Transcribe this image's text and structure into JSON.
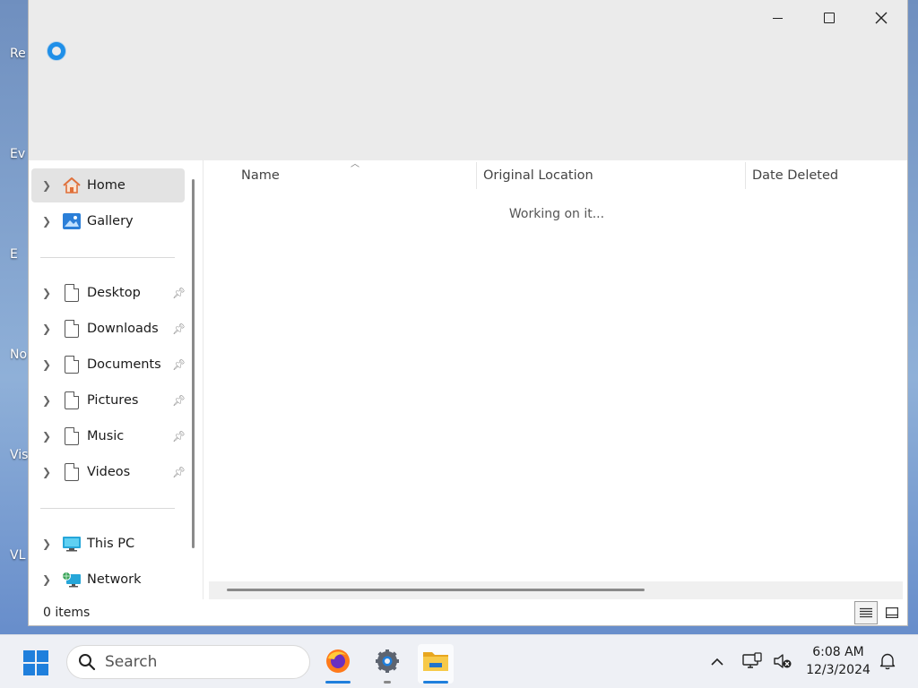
{
  "desktop": {
    "icon_labels": [
      "Re",
      "Ev",
      "E",
      "No",
      "Visu",
      "VL"
    ]
  },
  "window": {
    "controls": {
      "minimize_icon": "minimize-icon",
      "maximize_icon": "maximize-icon",
      "close_icon": "close-icon"
    }
  },
  "nav": {
    "top_items": [
      {
        "label": "Home",
        "icon": "home-icon",
        "selected": true
      },
      {
        "label": "Gallery",
        "icon": "gallery-icon"
      }
    ],
    "quick_access": [
      {
        "label": "Desktop"
      },
      {
        "label": "Downloads"
      },
      {
        "label": "Documents"
      },
      {
        "label": "Pictures"
      },
      {
        "label": "Music"
      },
      {
        "label": "Videos"
      }
    ],
    "bottom_items": [
      {
        "label": "This PC",
        "icon": "monitor-icon"
      },
      {
        "label": "Network",
        "icon": "network-icon"
      }
    ]
  },
  "content": {
    "columns": [
      "Name",
      "Original Location",
      "Date Deleted"
    ],
    "status_message": "Working on it..."
  },
  "statusbar": {
    "item_count": "0 items"
  },
  "taskbar": {
    "search_placeholder": "Search",
    "clock_time": "6:08 AM",
    "clock_date": "12/3/2024"
  },
  "colors": {
    "accent": "#1f7fdc",
    "folder": "#f2c12e"
  }
}
